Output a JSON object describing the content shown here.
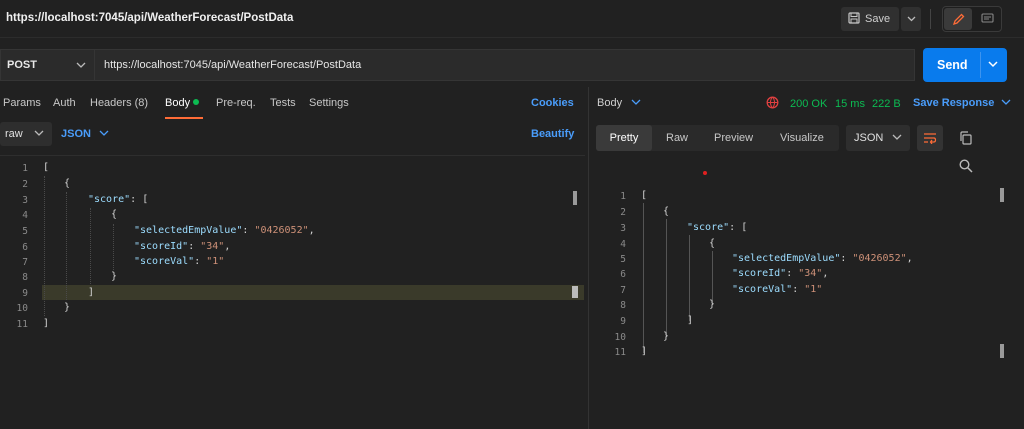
{
  "request": {
    "title": "https://localhost:7045/api/WeatherForecast/PostData",
    "method": "POST",
    "url": "https://localhost:7045/api/WeatherForecast/PostData",
    "send_label": "Send"
  },
  "toolbar": {
    "save_label": "Save"
  },
  "tabs": {
    "params": "Params",
    "auth": "Auth",
    "headers": "Headers (8)",
    "body": "Body",
    "prereq": "Pre-req.",
    "tests": "Tests",
    "settings": "Settings",
    "cookies": "Cookies"
  },
  "body_options": {
    "mode": "raw",
    "language": "JSON",
    "beautify": "Beautify"
  },
  "request_code": {
    "line_numbers": [
      "1",
      "2",
      "3",
      "4",
      "5",
      "6",
      "7",
      "8",
      "9",
      "10",
      "11"
    ],
    "l1": "[",
    "l2": "{",
    "l3_key": "\"score\"",
    "l3_rest": ": [",
    "l4": "{",
    "l5_key": "\"selectedEmpValue\"",
    "l5_val": "\"0426052\"",
    "l6_key": "\"scoreId\"",
    "l6_val": "\"34\"",
    "l7_key": "\"scoreVal\"",
    "l7_val": "\"1\"",
    "l8": "}",
    "l9": "]",
    "l10": "}",
    "l11": "]"
  },
  "response": {
    "body_label": "Body",
    "status": "200 OK",
    "time": "15 ms",
    "size": "222 B",
    "save_response": "Save Response",
    "view_tabs": [
      "Pretty",
      "Raw",
      "Preview",
      "Visualize"
    ],
    "format": "JSON"
  },
  "response_code": {
    "line_numbers": [
      "1",
      "2",
      "3",
      "4",
      "5",
      "6",
      "7",
      "8",
      "9",
      "10",
      "11"
    ]
  },
  "icons": {
    "save": "floppy-icon",
    "edit": "pencil-icon",
    "comment": "comment-icon",
    "globe": "globe-icon",
    "wrap": "wrap-lines-icon",
    "copy": "copy-icon",
    "search": "search-icon"
  },
  "colors": {
    "accent_orange": "#ff6c37",
    "send_blue": "#097bed",
    "link_blue": "#4a9dfb",
    "status_green": "#0cbb52",
    "string_color": "#ce9178",
    "key_color": "#9cdcfe"
  }
}
